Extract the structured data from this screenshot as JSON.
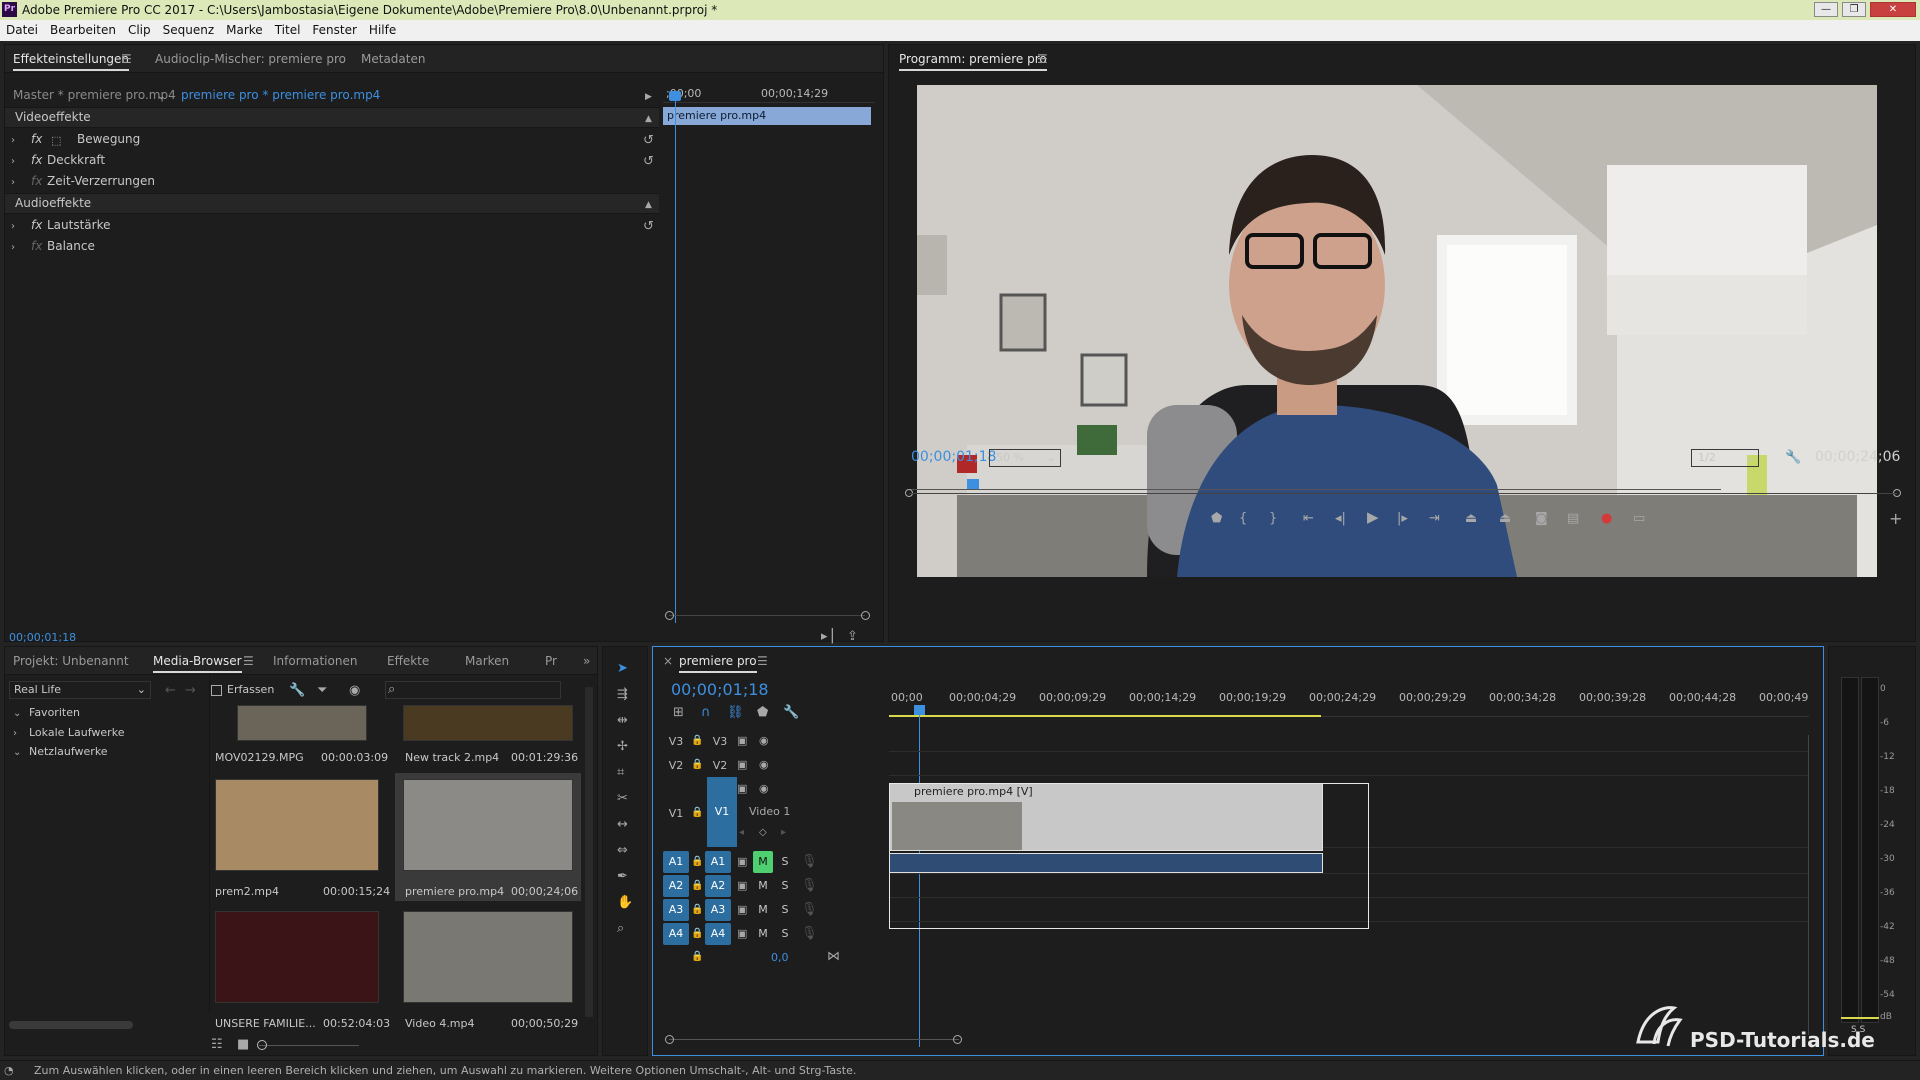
{
  "window": {
    "title": "Adobe Premiere Pro CC 2017 - C:\\Users\\Jambostasia\\Eigene Dokumente\\Adobe\\Premiere Pro\\8.0\\Unbenannt.prproj *",
    "logo": "Pr",
    "minimize": "—",
    "maximize": "❐",
    "close": "✕"
  },
  "menu": [
    "Datei",
    "Bearbeiten",
    "Clip",
    "Sequenz",
    "Marke",
    "Titel",
    "Fenster",
    "Hilfe"
  ],
  "effects_panel": {
    "tabs": [
      "Effekteinstellungen",
      "Audioclip-Mischer: premiere pro",
      "Metadaten"
    ],
    "menu_icon": "☰",
    "master_label": "Master * premiere pro.mp4",
    "clip_selector": "premiere pro * premiere pro.mp4",
    "ruler_start": ";00;00",
    "ruler_end": "00;00;14;29",
    "clip_bar": "premiere pro.mp4",
    "video_section": "Videoeffekte",
    "video_effects": [
      "Bewegung",
      "Deckkraft",
      "Zeit-Verzerrungen"
    ],
    "audio_section": "Audioeffekte",
    "audio_effects": [
      "Lautstärke",
      "Balance"
    ],
    "fx": "fx",
    "timecode": "00;00;01;18"
  },
  "program_monitor": {
    "title": "Programm: premiere pro",
    "menu_icon": "☰",
    "timecode": "00;00;01;18",
    "zoom": "50 %",
    "resolution": "1/2",
    "duration": "00;00;24;06",
    "add_button": "+"
  },
  "project_panel": {
    "tabs": [
      "Projekt: Unbenannt",
      "Media-Browser",
      "Informationen",
      "Effekte",
      "Marken",
      "Pr"
    ],
    "menu_icon": "☰",
    "more": "»",
    "ingest_dropdown": "Real Life",
    "capture_label": "Erfassen",
    "tree": [
      "Favoriten",
      "Lokale Laufwerke",
      "Netzlaufwerke"
    ],
    "media": [
      {
        "name": "MOV02129.MPG",
        "duration": "00:00:03:09"
      },
      {
        "name": "New track 2.mp4",
        "duration": "00:01:29:36"
      },
      {
        "name": "prem2.mp4",
        "duration": "00:00:15;24"
      },
      {
        "name": "premiere pro.mp4",
        "duration": "00;00;24;06"
      },
      {
        "name": "UNSERE FAMILIE...",
        "duration": "00:52:04:03"
      },
      {
        "name": "Video 4.mp4",
        "duration": "00;00;50;29"
      }
    ]
  },
  "timeline": {
    "close": "×",
    "title": "premiere pro",
    "menu_icon": "☰",
    "timecode": "00;00;01;18",
    "ruler": [
      "00;00",
      "00;00;04;29",
      "00;00;09;29",
      "00;00;14;29",
      "00;00;19;29",
      "00;00;24;29",
      "00;00;29;29",
      "00;00;34;28",
      "00;00;39;28",
      "00;00;44;28",
      "00;00;49"
    ],
    "video_tracks": [
      "V3",
      "V2",
      "V1"
    ],
    "audio_tracks": [
      "A1",
      "A2",
      "A3",
      "A4"
    ],
    "video1_label": "Video 1",
    "clip_label": "premiere pro.mp4 [V]",
    "m": "M",
    "s": "S",
    "master_value": "0,0"
  },
  "meter": {
    "labels": [
      "0",
      "-6",
      "-12",
      "-18",
      "-24",
      "-30",
      "-36",
      "-42",
      "-48",
      "-54",
      "dB"
    ],
    "s": "S  S"
  },
  "status_bar": "Zum Auswählen klicken, oder in einen leeren Bereich klicken und ziehen, um Auswahl zu markieren. Weitere Optionen Umschalt-, Alt- und Strg-Taste.",
  "watermark": "PSD-Tutorials.de",
  "colors": {
    "accent": "#3d8fe0",
    "track_on": "#2d6ea0",
    "mute_on": "#4fd070"
  }
}
